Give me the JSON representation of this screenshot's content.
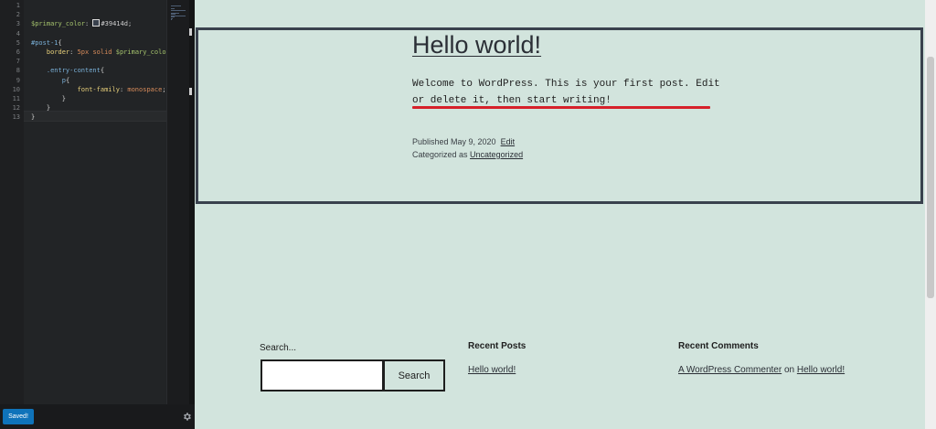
{
  "editor": {
    "lines": [
      {
        "n": "1",
        "tokens": []
      },
      {
        "n": "2",
        "tokens": []
      },
      {
        "n": "3",
        "tokens": [
          {
            "t": "var",
            "s": "$primary_color"
          },
          {
            "t": "punc",
            "s": ": "
          },
          {
            "t": "swatch",
            "s": ""
          },
          {
            "t": "hex",
            "s": "#39414d"
          },
          {
            "t": "punc",
            "s": ";"
          }
        ]
      },
      {
        "n": "4",
        "tokens": []
      },
      {
        "n": "5",
        "tokens": [
          {
            "t": "sel",
            "s": "#post-1"
          },
          {
            "t": "punc",
            "s": "{"
          }
        ]
      },
      {
        "n": "6",
        "tokens": [
          {
            "t": "ind",
            "s": "    "
          },
          {
            "t": "prop",
            "s": "border"
          },
          {
            "t": "punc",
            "s": ": "
          },
          {
            "t": "val",
            "s": "5px solid "
          },
          {
            "t": "var",
            "s": "$primary_color"
          }
        ]
      },
      {
        "n": "7",
        "tokens": []
      },
      {
        "n": "8",
        "tokens": [
          {
            "t": "ind",
            "s": "    "
          },
          {
            "t": "sel",
            "s": ".entry-content"
          },
          {
            "t": "punc",
            "s": "{"
          }
        ]
      },
      {
        "n": "9",
        "tokens": [
          {
            "t": "ind",
            "s": "        "
          },
          {
            "t": "sel",
            "s": "p"
          },
          {
            "t": "punc",
            "s": "{"
          }
        ]
      },
      {
        "n": "10",
        "tokens": [
          {
            "t": "ind",
            "s": "            "
          },
          {
            "t": "prop",
            "s": "font-family"
          },
          {
            "t": "punc",
            "s": ": "
          },
          {
            "t": "val",
            "s": "monospace"
          },
          {
            "t": "punc",
            "s": ";"
          }
        ]
      },
      {
        "n": "11",
        "tokens": [
          {
            "t": "ind",
            "s": "        "
          },
          {
            "t": "punc",
            "s": "}"
          }
        ]
      },
      {
        "n": "12",
        "tokens": [
          {
            "t": "ind",
            "s": "    "
          },
          {
            "t": "punc",
            "s": "}"
          }
        ]
      },
      {
        "n": "13",
        "tokens": [
          {
            "t": "punc",
            "s": "}"
          }
        ]
      }
    ],
    "saved_label": "Saved!",
    "gear_icon": "gear-icon"
  },
  "post": {
    "title": "Hello world!",
    "content": "Welcome to WordPress. This is your first post. Edit or delete it, then start writing!",
    "published_prefix": "Published ",
    "published_date": "May 9, 2020",
    "edit_label": "Edit",
    "categorized_prefix": "Categorized as ",
    "category": "Uncategorized"
  },
  "widgets": {
    "search_label": "Search...",
    "search_button": "Search",
    "search_value": "",
    "recent_posts_title": "Recent Posts",
    "recent_post_link": "Hello world!",
    "recent_comments_title": "Recent Comments",
    "comment_author": "A WordPress Commenter",
    "comment_on": " on ",
    "comment_post": "Hello world!"
  },
  "colors": {
    "primary": "#39414d",
    "background": "#d2e4dd",
    "annotation": "#d6202a",
    "saved_button": "#0f73ba"
  }
}
